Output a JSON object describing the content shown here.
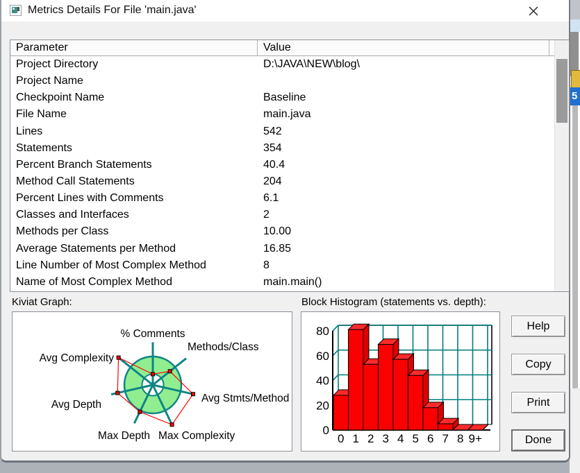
{
  "window": {
    "title": "Metrics Details For File 'main.java'"
  },
  "table": {
    "columns": [
      "Parameter",
      "Value"
    ],
    "rows": [
      [
        "Project Directory",
        "D:\\JAVA\\NEW\\blog\\"
      ],
      [
        "Project Name",
        ""
      ],
      [
        "Checkpoint Name",
        "Baseline"
      ],
      [
        "File Name",
        "main.java"
      ],
      [
        "Lines",
        "542"
      ],
      [
        "Statements",
        "354"
      ],
      [
        "Percent Branch Statements",
        "40.4"
      ],
      [
        "Method Call Statements",
        "204"
      ],
      [
        "Percent Lines with Comments",
        "6.1"
      ],
      [
        "Classes and Interfaces",
        "2"
      ],
      [
        "Methods per Class",
        "10.00"
      ],
      [
        "Average Statements per Method",
        "16.85"
      ],
      [
        "Line Number of Most Complex Method",
        "8"
      ],
      [
        "Name of Most Complex Method",
        "main.main()"
      ]
    ]
  },
  "sections": {
    "kiviat_label": "Kiviat Graph:",
    "histogram_label": "Block Histogram (statements vs. depth):"
  },
  "buttons": {
    "help": "Help",
    "copy": "Copy",
    "print": "Print",
    "done": "Done"
  },
  "background_strip": {
    "selected_item": "5"
  },
  "chart_data": [
    {
      "type": "radar",
      "title": "Kiviat Graph",
      "axes": [
        "% Comments",
        "Methods/Class",
        "Avg Stmts/Method",
        "Max Complexity",
        "Max Depth",
        "Avg Depth",
        "Avg Complexity"
      ],
      "values": [
        0.38,
        0.77,
        1.45,
        1.55,
        1.05,
        1.27,
        1.54
      ],
      "value_units": "fraction of outer ring radius",
      "ring_inner_fraction": 0.38,
      "spoke_length_fraction": 1.5,
      "colors": {
        "spoke": "#0d8585",
        "ring_fill": "#90ee90",
        "polygon": "#ff0000",
        "marker_fill": "#ff0000",
        "marker_stroke": "#000000"
      }
    },
    {
      "type": "bar",
      "title": "Block Histogram (statements vs. depth)",
      "categories": [
        "0",
        "1",
        "2",
        "3",
        "4",
        "5",
        "6",
        "7",
        "8",
        "9+"
      ],
      "values": [
        28,
        81,
        53,
        69,
        57,
        44,
        18,
        5,
        0,
        0
      ],
      "xlabel": "depth",
      "ylabel": "statements",
      "ylim": [
        0,
        85
      ],
      "yticks": [
        0,
        20,
        40,
        60,
        80
      ],
      "grid": true,
      "style": "3d",
      "colors": {
        "bar_front": "#fb0000",
        "bar_top": "#ff2a2a",
        "bar_side": "#dd0000",
        "grid": "#007d7d",
        "axis": "#000000"
      }
    }
  ]
}
